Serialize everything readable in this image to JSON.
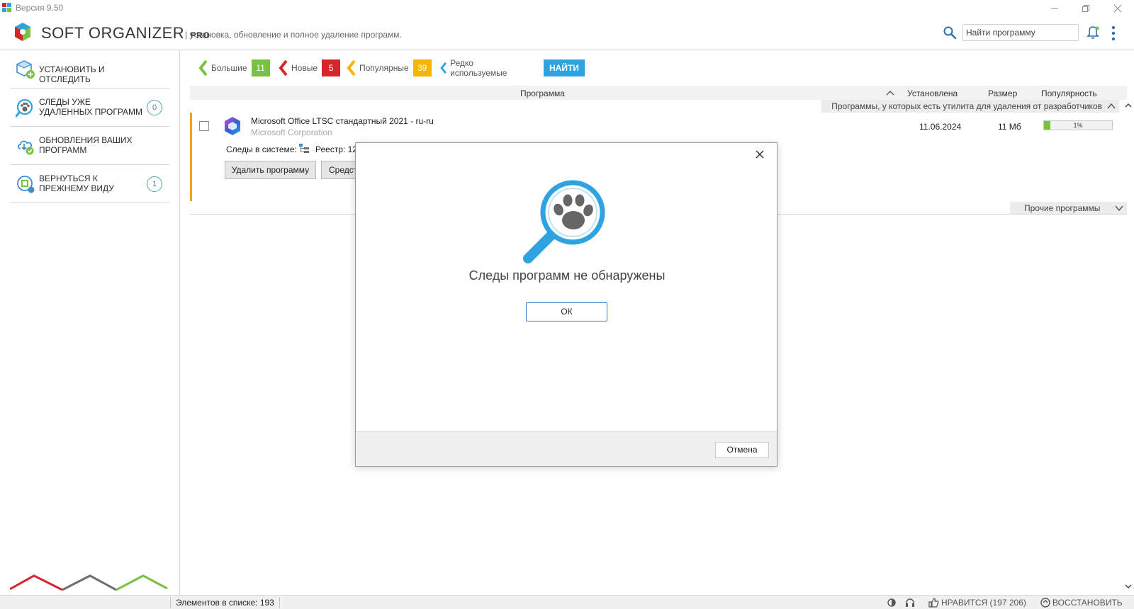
{
  "window": {
    "version_text": "Версия 9.50"
  },
  "header": {
    "brand": "SOFT ORGANIZER",
    "brand_suffix": "PRO",
    "tagline": "| установка, обновление и полное удаление программ.",
    "search_placeholder": "Найти программу"
  },
  "sidebar": {
    "items": [
      {
        "label": "УСТАНОВИТЬ И ОТСЛЕДИТЬ",
        "badge": ""
      },
      {
        "label": "СЛЕДЫ УЖЕ УДАЛЕННЫХ ПРОГРАММ",
        "badge": "0"
      },
      {
        "label": "ОБНОВЛЕНИЯ ВАШИХ ПРОГРАММ",
        "badge": ""
      },
      {
        "label": "ВЕРНУТЬСЯ К ПРЕЖНЕМУ ВИДУ",
        "badge": "1"
      }
    ]
  },
  "filters": {
    "tabs": [
      {
        "label": "Большие",
        "count": "11",
        "color": "#7ac143"
      },
      {
        "label": "Новые",
        "count": "5",
        "color": "#d7262b"
      },
      {
        "label": "Популярные",
        "count": "39",
        "color": "#f7b500"
      },
      {
        "label": "Редко используемые",
        "count": "",
        "color": "#2fa3e0"
      }
    ],
    "find_label": "НАЙТИ"
  },
  "table": {
    "columns": {
      "program": "Программа",
      "installed": "Установлена",
      "size": "Размер",
      "popularity": "Популярность"
    },
    "group_with_uninstaller": "Программы, у которых есть утилита для удаления от разработчиков",
    "group_other": "Прочие программы",
    "row": {
      "name": "Microsoft Office LTSC стандартный 2021 - ru-ru",
      "vendor": "Microsoft Corporation",
      "traces_label": "Следы в системе:",
      "registry": "Реестр: 12",
      "uninstall_button": "Удалить программу",
      "tools_button": "Средст",
      "installed": "11.06.2024",
      "size": "11 Мб",
      "popularity_text": "1%",
      "popularity_fraction": 0.09
    }
  },
  "statusbar": {
    "count": "Элементов в списке: 193",
    "like": "НРАВИТСЯ (197 206)",
    "restore": "ВОССТАНОВИТЬ"
  },
  "modal": {
    "message": "Следы программ не обнаружены",
    "ok_label": "ОК",
    "cancel_label": "Отмена"
  },
  "colors": {
    "accent_blue": "#2fa3e0",
    "row_accent": "#f2a21b",
    "green": "#7ac143",
    "red": "#d7262b",
    "gray": "#6f6f6f"
  }
}
